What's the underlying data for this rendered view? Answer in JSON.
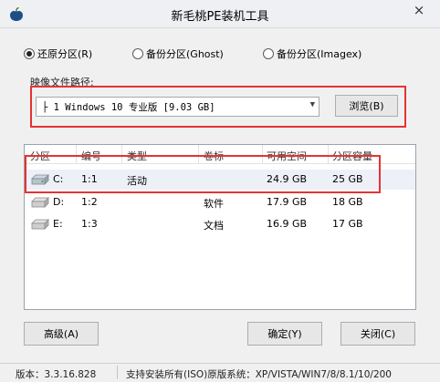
{
  "window": {
    "title": "新毛桃PE装机工具",
    "close_label": "×",
    "icon": "peach-logo-icon"
  },
  "modes": [
    {
      "label": "还原分区(R)",
      "checked": true
    },
    {
      "label": "备份分区(Ghost)",
      "checked": false
    },
    {
      "label": "备份分区(Imagex)",
      "checked": false
    }
  ],
  "image_path": {
    "label": "映像文件路径:",
    "value": "├ 1 Windows 10 专业版 [9.03 GB]",
    "browse_label": "浏览(B)"
  },
  "table": {
    "columns": [
      "分区",
      "编号",
      "类型",
      "卷标",
      "可用空间",
      "分区容量"
    ],
    "rows": [
      {
        "drive": "C:",
        "number": "1:1",
        "type": "活动",
        "label": "",
        "free": "24.9 GB",
        "capacity": "25 GB",
        "selected": true
      },
      {
        "drive": "D:",
        "number": "1:2",
        "type": "",
        "label": "软件",
        "free": "17.9 GB",
        "capacity": "18 GB",
        "selected": false
      },
      {
        "drive": "E:",
        "number": "1:3",
        "type": "",
        "label": "文档",
        "free": "16.9 GB",
        "capacity": "17 GB",
        "selected": false
      }
    ]
  },
  "buttons": {
    "advanced": "高级(A)",
    "ok": "确定(Y)",
    "close": "关闭(C)"
  },
  "status": {
    "version": "版本：3.3.16.828",
    "support": "支持安装所有(ISO)原版系统：XP/VISTA/WIN7/8/8.1/10/200"
  },
  "colors": {
    "highlight": "#e53333",
    "selected_row": "#eef0f8",
    "window_bg": "#f0f0f0"
  }
}
